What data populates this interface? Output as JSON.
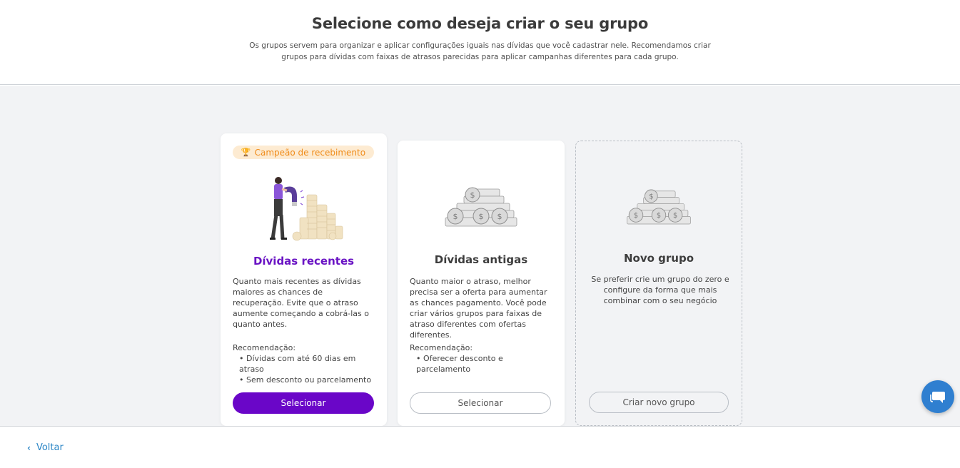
{
  "header": {
    "title": "Selecione como deseja criar o seu grupo",
    "subtitle": "Os grupos servem para organizar e aplicar configurações iguais nas dívidas que você cadastrar nele. Recomendamos criar grupos para dívidas com faixas de atrasos parecidas para aplicar campanhas diferentes para cada grupo."
  },
  "cards": [
    {
      "badge": "Campeão de recebimento",
      "badge_icon": "trophy-icon",
      "title": "Dívidas recentes",
      "description": "Quanto mais recentes as dívidas maiores as chances de recuperação. Evite que o atraso aumente começando a cobrá-las o quanto antes.",
      "rec_label": "Recomendação:",
      "rec_items": [
        "Dívidas com até 60 dias em atraso",
        "Sem desconto ou parcelamento"
      ],
      "button": "Selecionar",
      "illustration": "man-with-magnet-attracting-coins"
    },
    {
      "title": "Dívidas antigas",
      "description": "Quanto maior o atraso, melhor precisa ser a oferta para aumentar as chances pagamento. Você pode criar vários grupos para faixas de atraso diferentes com ofertas diferentes.",
      "rec_label": "Recomendação:",
      "rec_items": [
        "Oferecer desconto e parcelamento"
      ],
      "button": "Selecionar",
      "illustration": "grey-coin-pile"
    },
    {
      "title": "Novo grupo",
      "description": "Se preferir crie um grupo do zero e configure da forma que mais combinar com o seu negócio",
      "button": "Criar novo grupo",
      "illustration": "grey-coin-pile"
    }
  ],
  "footer": {
    "back_label": "Voltar"
  },
  "colors": {
    "primary": "#6a06c8",
    "link": "#2b86c6",
    "badge_bg": "#fdebd2",
    "badge_text": "#f08c1a",
    "chat": "#2f7fd0"
  }
}
